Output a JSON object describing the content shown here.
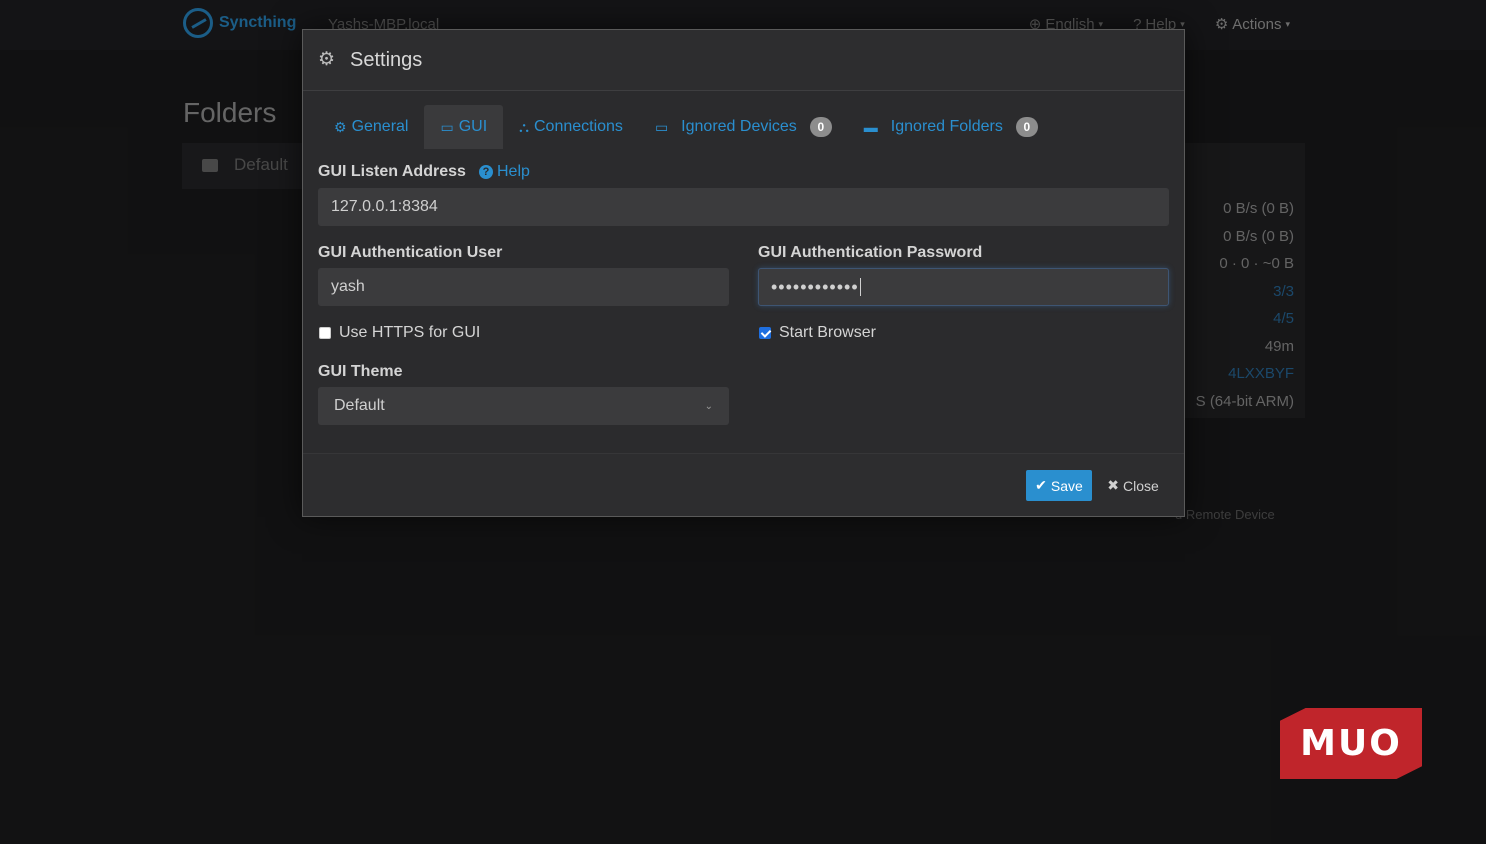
{
  "app": {
    "brand_name": "Syncthing",
    "hostname": "Yashs-MBP.local",
    "nav": {
      "language": "English",
      "help": "Help",
      "actions": "Actions"
    },
    "folders_title": "Folders",
    "folder_default": "Default",
    "device_stats": [
      "0 B/s (0 B)",
      "0 B/s (0 B)",
      "0  ·  0  ·  ~0 B",
      "3/3",
      "4/5",
      "49m",
      "4LXXBYF",
      "S (64-bit ARM)"
    ],
    "remote_device_button": "d Remote Device"
  },
  "modal": {
    "title": "Settings",
    "tabs": [
      {
        "label": "General",
        "icon": "gear-icon"
      },
      {
        "label": "GUI",
        "icon": "desktop-icon",
        "active": true
      },
      {
        "label": "Connections",
        "icon": "sitemap-icon"
      },
      {
        "label": "Ignored Devices",
        "icon": "laptop-icon",
        "badge": "0"
      },
      {
        "label": "Ignored Folders",
        "icon": "folder-icon",
        "badge": "0"
      }
    ],
    "listen_address": {
      "label": "GUI Listen Address",
      "help": "Help",
      "value": "127.0.0.1:8384"
    },
    "auth_user": {
      "label": "GUI Authentication User",
      "value": "yash"
    },
    "auth_password": {
      "label": "GUI Authentication Password",
      "masked_value": "••••••••••••"
    },
    "use_https": {
      "label": "Use HTTPS for GUI",
      "checked": false
    },
    "start_browser": {
      "label": "Start Browser",
      "checked": true
    },
    "theme": {
      "label": "GUI Theme",
      "selected": "Default"
    },
    "save_label": "Save",
    "close_label": "Close"
  },
  "watermark": "MUO",
  "colors": {
    "accent": "#2a8fcf",
    "brand_red": "#c0252b",
    "surface": "#2b2b2d",
    "input_bg": "#3b3b3d"
  }
}
